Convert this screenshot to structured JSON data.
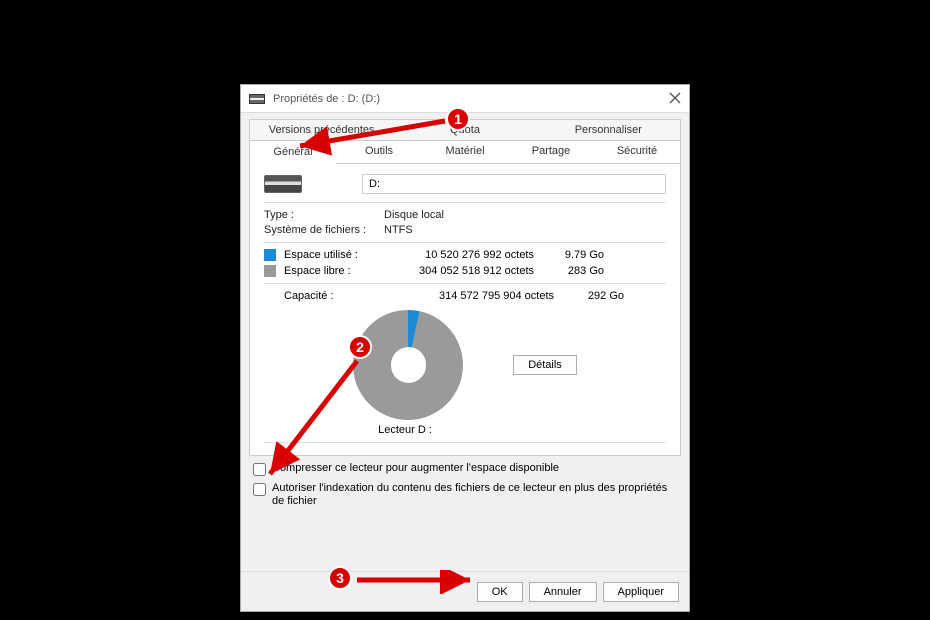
{
  "window": {
    "title": "Propriétés de : D: (D:)"
  },
  "tabs": {
    "row1": [
      "Versions précédentes",
      "Quota",
      "Personnaliser"
    ],
    "row2": [
      "Général",
      "Outils",
      "Matériel",
      "Partage",
      "Sécurité"
    ]
  },
  "drive": {
    "name_value": "D:",
    "type_label": "Type :",
    "type_value": "Disque local",
    "fs_label": "Système de fichiers :",
    "fs_value": "NTFS"
  },
  "usage": {
    "used_label": "Espace utilisé :",
    "used_bytes": "10 520 276 992 octets",
    "used_gb": "9.79 Go",
    "free_label": "Espace libre :",
    "free_bytes": "304 052 518 912 octets",
    "free_gb": "283 Go",
    "cap_label": "Capacité :",
    "cap_bytes": "314 572 795 904 octets",
    "cap_gb": "292 Go"
  },
  "pie": {
    "lecteur_label": "Lecteur D :",
    "details_btn": "Détails"
  },
  "checks": {
    "compress": "Compresser ce lecteur pour augmenter l'espace disponible",
    "index": "Autoriser l'indexation du contenu des fichiers de ce lecteur en plus des propriétés de fichier"
  },
  "buttons": {
    "ok": "OK",
    "cancel": "Annuler",
    "apply": "Appliquer"
  },
  "annotations": {
    "m1": "1",
    "m2": "2",
    "m3": "3"
  }
}
